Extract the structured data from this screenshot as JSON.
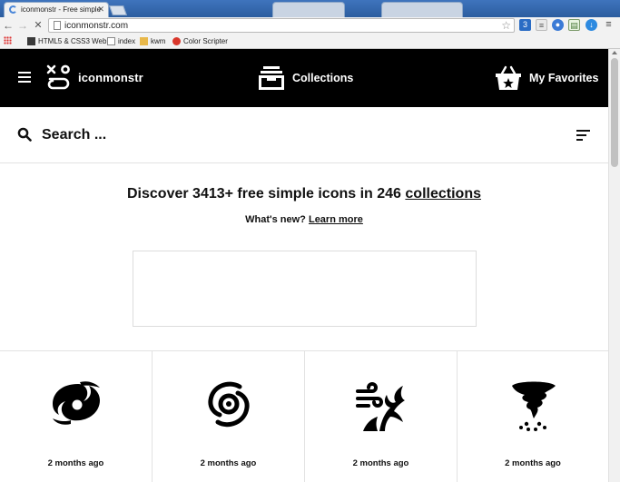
{
  "browser": {
    "active_tab_title": "iconmonstr - Free simple",
    "url": "iconmonstr.com",
    "bookmarks": [
      {
        "label": "HTML5 & CSS3 Web"
      },
      {
        "label": "index"
      },
      {
        "label": "kwm"
      },
      {
        "label": "Color Scripter"
      }
    ]
  },
  "header": {
    "brand": "iconmonstr",
    "nav": [
      {
        "label": "Collections",
        "icon": "collections-icon"
      },
      {
        "label": "My Favorites",
        "icon": "basket-star-icon"
      }
    ]
  },
  "search": {
    "placeholder": "Search ..."
  },
  "hero": {
    "headline_prefix": "Discover 3413+ free simple icons in 246",
    "headline_link": "collections",
    "sub_prefix": "What's new?",
    "sub_link": "Learn more"
  },
  "icons": [
    {
      "name": "hurricane-icon",
      "date": "2 months ago"
    },
    {
      "name": "hurricane-outline-icon",
      "date": "2 months ago"
    },
    {
      "name": "wind-tree-icon",
      "date": "2 months ago"
    },
    {
      "name": "tornado-icon",
      "date": "2 months ago"
    }
  ],
  "colors": {
    "header_bg": "#000000",
    "text": "#111111",
    "divider": "#e2e2e2"
  }
}
